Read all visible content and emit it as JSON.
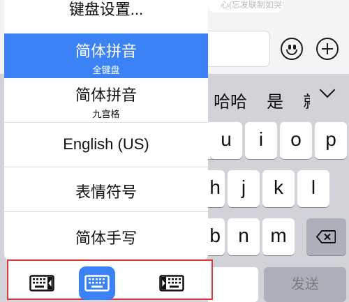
{
  "background": {
    "bubble_text": "心(忘发联制如哭)",
    "candidates": [
      "哈哈",
      "是",
      "就"
    ],
    "keys": {
      "row1": [
        "u",
        "i",
        "o",
        "p"
      ],
      "row2": [
        "h",
        "j",
        "k",
        "l"
      ],
      "row3": [
        "b",
        "n",
        "m"
      ]
    },
    "send_label": "发送"
  },
  "menu": {
    "items": [
      {
        "label": "键盘设置...",
        "sub": ""
      },
      {
        "label": "简体拼音",
        "sub": "全键盘",
        "selected": true
      },
      {
        "label": "简体拼音",
        "sub": "九宫格"
      },
      {
        "label": "English (US)",
        "sub": ""
      },
      {
        "label": "表情符号",
        "sub": ""
      },
      {
        "label": "简体手写",
        "sub": ""
      }
    ],
    "keyboard_modes": [
      "left-handed",
      "standard",
      "right-handed"
    ],
    "active_mode": "standard"
  },
  "colors": {
    "accent": "#3b82f6",
    "highlight_border": "#e0383e"
  }
}
